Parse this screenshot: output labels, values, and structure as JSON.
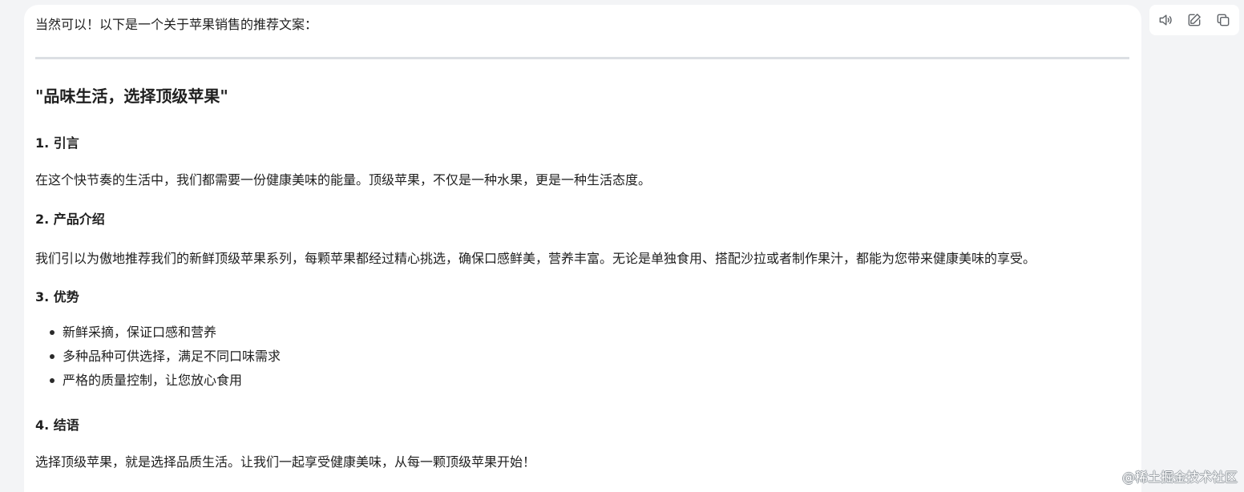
{
  "message": {
    "intro": "当然可以！以下是一个关于苹果销售的推荐文案：",
    "headline": "\"品味生活，选择顶级苹果\"",
    "sections": [
      {
        "heading": "1. 引言",
        "text": "在这个快节奏的生活中，我们都需要一份健康美味的能量。顶级苹果，不仅是一种水果，更是一种生活态度。"
      },
      {
        "heading": "2. 产品介绍",
        "text": "我们引以为傲地推荐我们的新鲜顶级苹果系列，每颗苹果都经过精心挑选，确保口感鲜美，营养丰富。无论是单独食用、搭配沙拉或者制作果汁，都能为您带来健康美味的享受。"
      },
      {
        "heading": "3. 优势",
        "bullets": [
          "新鲜采摘，保证口感和营养",
          "多种品种可供选择，满足不同口味需求",
          "严格的质量控制，让您放心食用"
        ]
      },
      {
        "heading": "4. 结语",
        "text": "选择顶级苹果，就是选择品质生活。让我们一起享受健康美味，从每一颗顶级苹果开始！"
      }
    ]
  },
  "toolbar": {
    "icons": [
      "speaker-icon",
      "edit-icon",
      "copy-icon"
    ]
  },
  "watermark": {
    "text": "@稀土掘金技术社区"
  }
}
